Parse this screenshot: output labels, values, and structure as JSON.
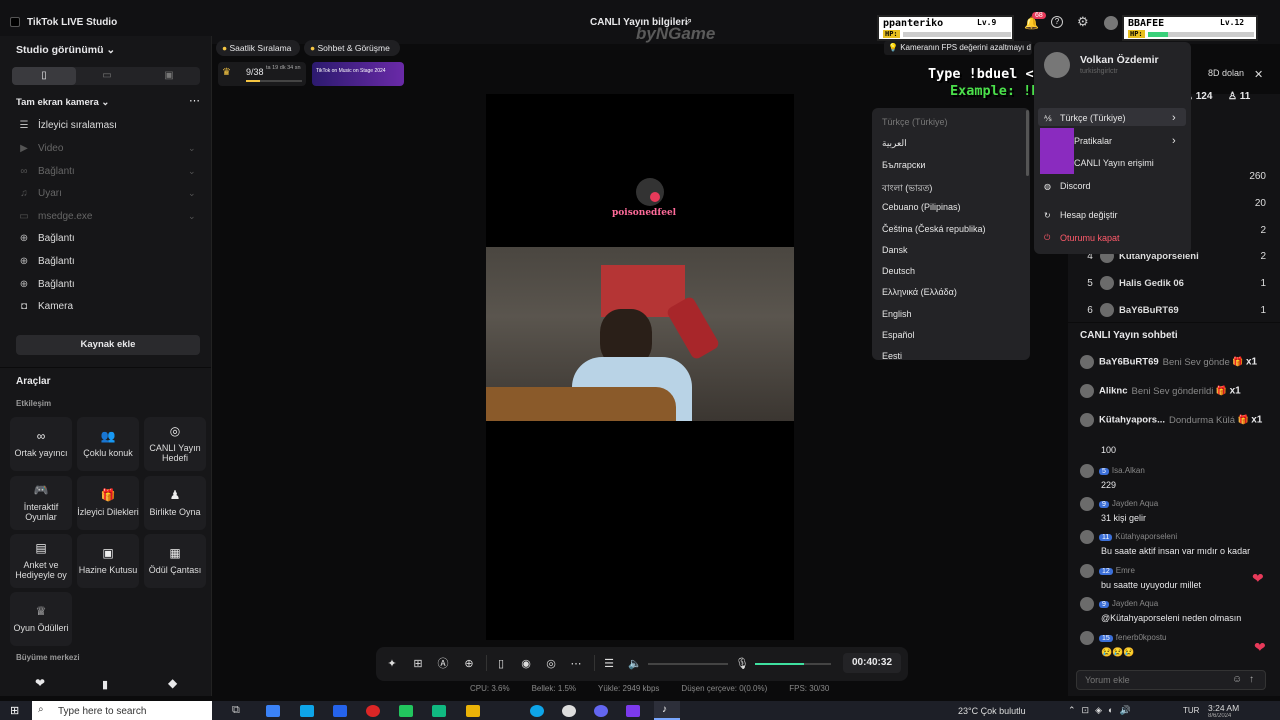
{
  "app": {
    "title": "TikTok LIVE Studio",
    "center_title": "CANLI Yayın bilgileri",
    "watermark": "byNGame"
  },
  "game_hud": {
    "p1": {
      "name": "ppanteriko",
      "level": "Lv.9",
      "hp_label": "HP:"
    },
    "p2": {
      "name": "BBAFEE",
      "level": "Lv.12",
      "hp_label": "HP:"
    },
    "notif_count": "68",
    "command_line1": "Type !bduel <name> to play",
    "command_line2": "Example: !bduel BBAFEE",
    "fps_warning": "Kameranın FPS değerini azaltmayı d"
  },
  "left": {
    "studio_view": "Studio görünümü",
    "fullscreen_camera": "Tam ekran kamera",
    "sources": [
      {
        "icon": "ranking-icon",
        "label": "İzleyici sıralaması",
        "dim": false
      },
      {
        "icon": "video-icon",
        "label": "Video",
        "dim": true
      },
      {
        "icon": "link-icon",
        "label": "Bağlantı",
        "dim": true
      },
      {
        "icon": "bell-icon",
        "label": "Uyarı",
        "dim": true
      },
      {
        "icon": "window-icon",
        "label": "msedge.exe",
        "dim": true
      },
      {
        "icon": "globe-icon",
        "label": "Bağlantı",
        "dim": false
      },
      {
        "icon": "globe-icon",
        "label": "Bağlantı",
        "dim": false
      },
      {
        "icon": "globe-icon",
        "label": "Bağlantı",
        "dim": false
      },
      {
        "icon": "camera-icon",
        "label": "Kamera",
        "dim": false
      }
    ],
    "add_source": "Kaynak ekle",
    "tools_title": "Araçlar",
    "interaction": "Etkileşim",
    "tools": [
      {
        "icon": "link-icon",
        "label": "Ortak yayıncı"
      },
      {
        "icon": "users-icon",
        "label": "Çoklu konuk"
      },
      {
        "icon": "target-icon",
        "label": "CANLI Yayın Hedefi"
      },
      {
        "icon": "gamepad-icon",
        "label": "İnteraktif Oyunlar"
      },
      {
        "icon": "gift-icon",
        "label": "İzleyici Dilekleri"
      },
      {
        "icon": "play-together-icon",
        "label": "Birlikte Oyna"
      },
      {
        "icon": "poll-icon",
        "label": "Anket ve Hediyeyle oy"
      },
      {
        "icon": "treasure-icon",
        "label": "Hazine Kutusu"
      },
      {
        "icon": "bag-icon",
        "label": "Ödül Çantası"
      },
      {
        "icon": "trophy-icon",
        "label": "Oyun Ödülleri"
      }
    ],
    "growth": "Büyüme merkezi"
  },
  "top_chips": {
    "hourly_rank": "Saatlik Sıralama",
    "chat_meet": "Sohbet & Görüşme",
    "progress": "9/38",
    "time_left": "ta 19 dk 34 sn",
    "banner": "TikTok on Music on Stage 2024"
  },
  "lang_menu": {
    "items": [
      "Türkçe (Türkiye)",
      "العربية",
      "Български",
      "বাংলা (ভারত)",
      "Cebuano (Pilipinas)",
      "Čeština (Česká republika)",
      "Dansk",
      "Deutsch",
      "Ελληνικά (Ελλάδα)",
      "English",
      "Español",
      "Eesti"
    ]
  },
  "account_menu": {
    "name": "Volkan Özdemir",
    "handle": "turkishgirlctr",
    "items": [
      "Türkçe (Türkiye)",
      "Pratikalar",
      "CANLI Yayın erişimi",
      "Discord",
      "Hesap değiştir",
      "Oturumu kapat"
    ]
  },
  "right": {
    "dollar": "8D dolan",
    "viewers": "124",
    "likes": "11",
    "ranks": [
      {
        "n": "",
        "name": "",
        "val": "260"
      },
      {
        "n": "",
        "name": "",
        "val": "20"
      },
      {
        "n": "",
        "name": "",
        "val": "2"
      },
      {
        "n": "4",
        "name": "Kütahyaporseleni",
        "val": "2"
      },
      {
        "n": "5",
        "name": "Halis Gedik 06",
        "val": "1"
      },
      {
        "n": "6",
        "name": "BaY6BuRT69",
        "val": "1"
      }
    ],
    "chat_title": "CANLI Yayın sohbeti",
    "gifts": [
      {
        "name": "BaY6BuRT69",
        "text": "Beni Sev gönde",
        "x": "x1"
      },
      {
        "name": "Aliknc",
        "text": "Beni Sev gönderildi",
        "x": "x1"
      },
      {
        "name": "Kütahyapors...",
        "text": "Dondurma Külá",
        "x": "x1"
      }
    ],
    "chat_top": "100",
    "messages": [
      {
        "lvl": "5",
        "user": "Isa.Alkan",
        "text": "229"
      },
      {
        "lvl": "9",
        "user": "Jayden Aqua",
        "text": "31 kişi gelir"
      },
      {
        "lvl": "11",
        "user": "Kütahyaporseleni",
        "text": "Bu saate aktif insan var mıdır o kadar"
      },
      {
        "lvl": "12",
        "user": "Emre",
        "text": "bu saatte uyuyodur millet"
      },
      {
        "lvl": "9",
        "user": "Jayden Aqua",
        "text": "@Kütahyaporseleni neden olmasın"
      },
      {
        "lvl": "15",
        "user": "fenerb0kpostu",
        "text": "😢😢😢"
      }
    ],
    "comment_placeholder": "Yorum ekle"
  },
  "overlay": {
    "streamer_name": "poisonedfeel"
  },
  "controls": {
    "timer": "00:40:32",
    "mic_level": 0.65,
    "volume_level": 0.0
  },
  "status": {
    "cpu": "CPU: 3.6%",
    "mem": "Bellek: 1.5%",
    "upload": "Yükle: 2949 kbps",
    "drop": "Düşen çerçeve: 0(0.0%)",
    "fps": "FPS: 30/30"
  },
  "taskbar": {
    "search": "Type here to search",
    "weather": "23°C Çok bulutlu",
    "lang": "TUR",
    "time": "3:24 AM",
    "date": "8/6/2024"
  }
}
